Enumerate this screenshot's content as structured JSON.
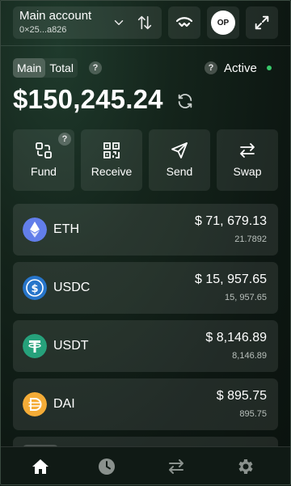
{
  "header": {
    "account_name": "Main account",
    "account_address": "0×25...a826",
    "network_badge": "OP",
    "icons": [
      "chevron-down-icon",
      "swap-vertical-icon",
      "wallet-connect-icon",
      "optimism-network-icon",
      "expand-icon"
    ]
  },
  "balance": {
    "tabs": [
      {
        "label": "Main",
        "selected": true
      },
      {
        "label": "Total",
        "selected": false
      }
    ],
    "help_glyph": "?",
    "status_label": "Active",
    "status_color": "#38c96a",
    "amount": "$150,245.24"
  },
  "actions": [
    {
      "label": "Fund",
      "icon": "fund-icon"
    },
    {
      "label": "Receive",
      "icon": "qr-code-icon"
    },
    {
      "label": "Send",
      "icon": "send-icon"
    },
    {
      "label": "Swap",
      "icon": "swap-arrows-icon"
    }
  ],
  "tokens": [
    {
      "symbol": "ETH",
      "value": "$ 71, 679.13",
      "amount": "21.7892",
      "color": "#627eea"
    },
    {
      "symbol": "USDC",
      "value": "$ 15, 957.65",
      "amount": "15, 957.65",
      "color": "#2775ca"
    },
    {
      "symbol": "USDT",
      "value": "$ 8,146.89",
      "amount": "8,146.89",
      "color": "#26a17b"
    },
    {
      "symbol": "DAI",
      "value": "$ 895.75",
      "amount": "895.75",
      "color": "#f5ac37"
    }
  ],
  "bottom_nav": [
    {
      "icon": "home-icon",
      "active": true
    },
    {
      "icon": "clock-icon",
      "active": false
    },
    {
      "icon": "swap-arrows-icon",
      "active": false
    },
    {
      "icon": "gear-icon",
      "active": false
    }
  ]
}
